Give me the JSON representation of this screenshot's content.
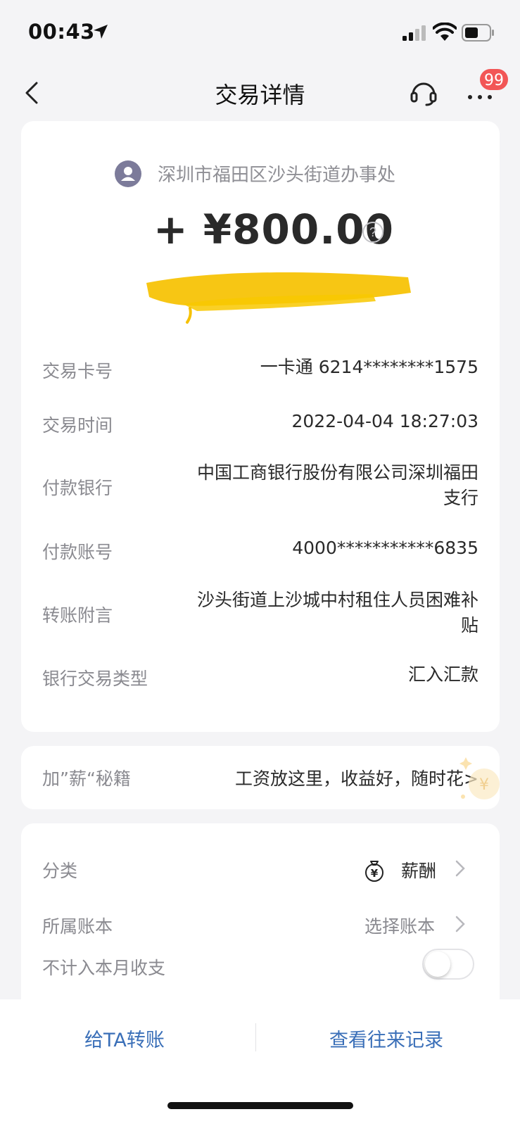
{
  "status_bar": {
    "time": "00:43"
  },
  "nav": {
    "title": "交易详情",
    "badge": "99"
  },
  "payer": {
    "name": "深圳市福田区沙头街道办事处"
  },
  "amount": "+ ¥800.00",
  "details": [
    {
      "label": "交易卡号",
      "value": "一卡通 6214********1575"
    },
    {
      "label": "交易时间",
      "value": "2022-04-04 18:27:03"
    },
    {
      "label": "付款银行",
      "value": "中国工商银行股份有限公司深圳福田支行"
    },
    {
      "label": "付款账号",
      "value": "4000***********6835"
    },
    {
      "label": "转账附言",
      "value": "沙头街道上沙城中村租住人员困难补贴"
    },
    {
      "label": "银行交易类型",
      "value": "汇入汇款"
    }
  ],
  "promo": {
    "label": "加”薪“秘籍",
    "text": "工资放这里，收益好，随时花>"
  },
  "settings": {
    "category_label": "分类",
    "category_value": "薪酬",
    "ledger_label": "所属账本",
    "ledger_value": "选择账本",
    "exclude_label": "不计入本月收支",
    "exclude_on": false
  },
  "bottom": {
    "transfer": "给TA转账",
    "history": "查看往来记录"
  },
  "colors": {
    "accent_blue": "#3a6fb8",
    "badge_red": "#f25656",
    "highlight_yellow": "#f6c100"
  }
}
